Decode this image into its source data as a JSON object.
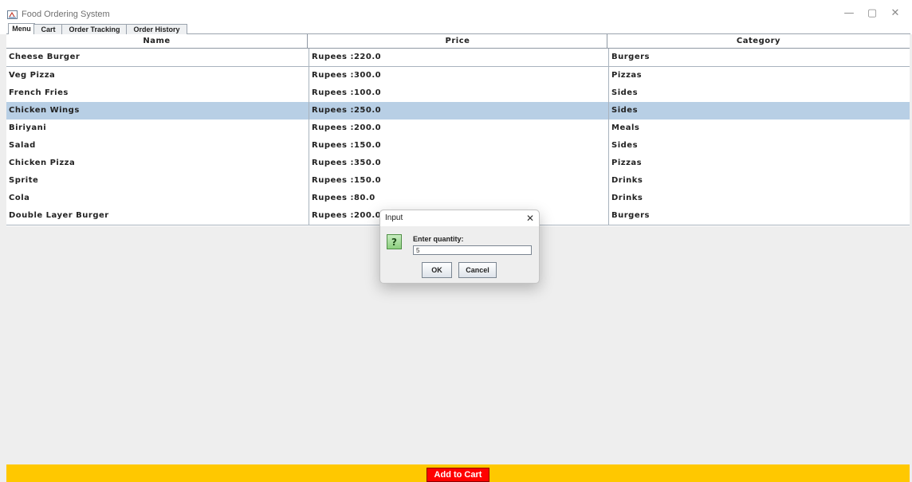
{
  "window": {
    "title": "Food Ordering System",
    "minimize_glyph": "—",
    "maximize_glyph": "▢",
    "close_glyph": "✕"
  },
  "tabs": [
    {
      "label": "Menu",
      "active": true
    },
    {
      "label": "Cart",
      "active": false
    },
    {
      "label": "Order Tracking",
      "active": false
    },
    {
      "label": "Order History",
      "active": false
    }
  ],
  "table": {
    "columns": [
      "Name",
      "Price",
      "Category"
    ],
    "rows": [
      {
        "name": "Cheese Burger",
        "price": "Rupees :220.0",
        "category": "Burgers"
      },
      {
        "name": "Veg Pizza",
        "price": "Rupees :300.0",
        "category": "Pizzas"
      },
      {
        "name": "French Fries",
        "price": "Rupees :100.0",
        "category": "Sides"
      },
      {
        "name": "Chicken Wings",
        "price": "Rupees :250.0",
        "category": "Sides"
      },
      {
        "name": "Biriyani",
        "price": "Rupees :200.0",
        "category": "Meals"
      },
      {
        "name": "Salad",
        "price": "Rupees :150.0",
        "category": "Sides"
      },
      {
        "name": "Chicken Pizza",
        "price": "Rupees :350.0",
        "category": "Pizzas"
      },
      {
        "name": "Sprite",
        "price": "Rupees :150.0",
        "category": "Drinks"
      },
      {
        "name": "Cola",
        "price": "Rupees :80.0",
        "category": "Drinks"
      },
      {
        "name": "Double Layer Burger",
        "price": "Rupees :200.0",
        "category": "Burgers"
      }
    ],
    "selected_row": 3
  },
  "bottom": {
    "add_to_cart_label": "Add to Cart",
    "bar_color": "#ffc800",
    "button_color": "#ff0000"
  },
  "dialog": {
    "title": "Input",
    "close_glyph": "✕",
    "icon_glyph": "?",
    "prompt": "Enter quantity:",
    "value": "5",
    "ok_label": "OK",
    "cancel_label": "Cancel"
  },
  "colors": {
    "selection": "#b8cfe5"
  }
}
